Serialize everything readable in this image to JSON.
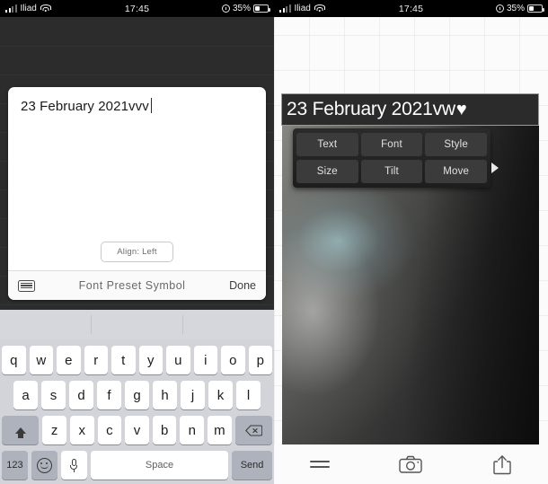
{
  "left_panel": {
    "status_bar": {
      "carrier": "Iliad",
      "time": "17:45",
      "battery_percent": "35%",
      "signal_icon": "signal-bars-icon",
      "wifi_icon": "wifi-icon",
      "alarm_icon": "alarm-clock-icon",
      "battery_icon": "battery-icon"
    },
    "editor": {
      "text_value": "23 February 2021vvv",
      "align_button": "Align: Left",
      "toolbar_label": "Font Preset Symbol",
      "done_label": "Done",
      "keyboard_icon": "keyboard-icon"
    },
    "keyboard": {
      "row1": [
        "q",
        "w",
        "e",
        "r",
        "t",
        "y",
        "u",
        "i",
        "o",
        "p"
      ],
      "row2": [
        "a",
        "s",
        "d",
        "f",
        "g",
        "h",
        "j",
        "k",
        "l"
      ],
      "row3": [
        "z",
        "x",
        "c",
        "v",
        "b",
        "n",
        "m"
      ],
      "shift_icon": "shift-icon",
      "delete_icon": "backspace-icon",
      "numeric_label": "123",
      "emoji_icon": "emoji-smiley-icon",
      "mic_icon": "microphone-icon",
      "space_label": "Space",
      "send_label": "Send"
    }
  },
  "right_panel": {
    "status_bar": {
      "carrier": "Iliad",
      "time": "17:45",
      "battery_percent": "35%",
      "signal_icon": "signal-bars-icon",
      "wifi_icon": "wifi-icon",
      "alarm_icon": "alarm-clock-icon",
      "battery_icon": "battery-icon"
    },
    "overlay": {
      "text_value": "23 February 2021vw",
      "heart_glyph": "♥"
    },
    "context_menu": {
      "items": [
        "Text",
        "Font",
        "Style",
        "Size",
        "Tilt",
        "Move"
      ],
      "more_arrow_icon": "arrow-right-icon"
    },
    "bottom_bar": {
      "menu_icon": "hamburger-menu-icon",
      "camera_icon": "camera-icon",
      "share_icon": "share-icon"
    }
  }
}
